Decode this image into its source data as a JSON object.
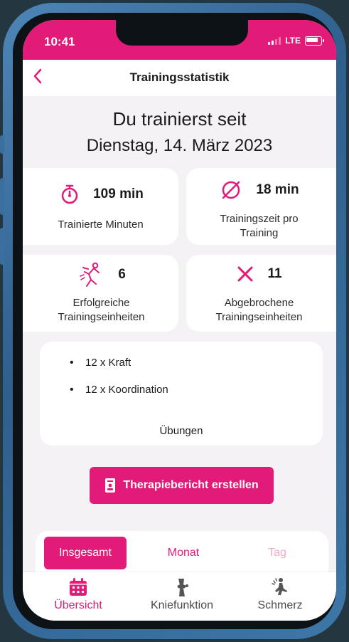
{
  "status_bar": {
    "time": "10:41",
    "network": "LTE"
  },
  "nav": {
    "back_icon": "chevron-left-icon",
    "title": "Trainingsstatistik"
  },
  "header": {
    "line1": "Du trainierst seit",
    "line2": "Dienstag, 14. März 2023"
  },
  "stats": [
    {
      "icon": "stopwatch-icon",
      "value": "109 min",
      "label": "Trainierte Minuten"
    },
    {
      "icon": "average-icon",
      "value": "18 min",
      "label_line1": "Trainingszeit pro",
      "label_line2": "Training"
    },
    {
      "icon": "exercise-person-icon",
      "value": "6",
      "label_line1": "Erfolgreiche",
      "label_line2": "Trainingseinheiten"
    },
    {
      "icon": "cross-icon",
      "value": "11",
      "label_line1": "Abgebrochene",
      "label_line2": "Trainingseinheiten"
    }
  ],
  "exercises": {
    "items": [
      "12 x Kraft",
      "12 x Koordination"
    ],
    "title": "Übungen"
  },
  "report_button": {
    "label": "Therapiebericht erstellen",
    "icon": "report-icon"
  },
  "segments": {
    "total": "Insgesamt",
    "month": "Monat",
    "day": "Tag"
  },
  "tabs": [
    {
      "label": "Übersicht",
      "icon": "calendar-icon",
      "active": true
    },
    {
      "label": "Kniefunktion",
      "icon": "knee-icon",
      "active": false
    },
    {
      "label": "Schmerz",
      "icon": "pain-icon",
      "active": false
    }
  ],
  "colors": {
    "accent": "#e31b78",
    "background": "#f4f2f5",
    "frame": "#4d86b8"
  }
}
